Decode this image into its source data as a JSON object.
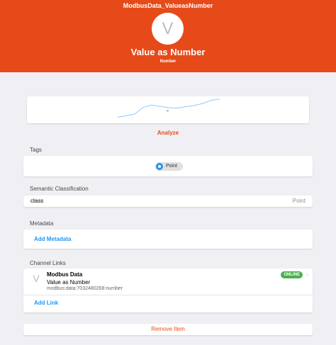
{
  "header": {
    "item_name": "ModbusData_ValueasNumber",
    "avatar_letter": "V",
    "title": "Value as Number",
    "subtitle": "Number",
    "color": "#e64a19"
  },
  "chart_preview": {
    "current_value": "-"
  },
  "chart_data": {
    "type": "line",
    "title": "",
    "xlabel": "",
    "ylabel": "",
    "values": [
      0.15,
      0.22,
      0.3,
      0.62,
      0.72,
      0.66,
      0.6,
      0.58,
      0.65,
      0.7,
      0.8,
      0.95,
      1.0
    ],
    "ylim": [
      0,
      1
    ],
    "color": "#90caf9"
  },
  "analyze_label": "Analyze",
  "tags": {
    "section_title": "Tags",
    "items": [
      {
        "label": "Point",
        "icon": "tag-icon"
      }
    ]
  },
  "semantic": {
    "section_title": "Semantic Classification",
    "label": "class",
    "value": "Point"
  },
  "metadata": {
    "section_title": "Metadata",
    "add_label": "Add Metadata"
  },
  "channel_links": {
    "section_title": "Channel Links",
    "items": [
      {
        "avatar_letter": "V",
        "thing": "Modbus Data",
        "channel": "Value as Number",
        "uid": "modbus:data:7032480268:number",
        "status": "ONLINE"
      }
    ],
    "add_label": "Add Link"
  },
  "remove_label": "Remove Item"
}
